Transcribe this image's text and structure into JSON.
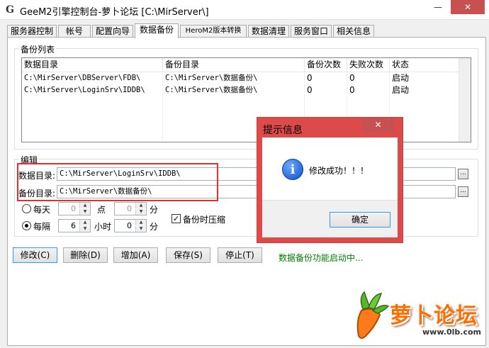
{
  "window": {
    "icon_glyph": "G",
    "title": "GeeM2引擎控制台-萝卜论坛 [C:\\MirServer\\]",
    "minimize_glyph": "—",
    "close_glyph": "✕"
  },
  "tabs": [
    {
      "label": "服务器控制"
    },
    {
      "label": "帐号"
    },
    {
      "label": "配置向导"
    },
    {
      "label": "数据备份"
    },
    {
      "label": "HeroM2版本转换"
    },
    {
      "label": "数据清理"
    },
    {
      "label": "服务窗口"
    },
    {
      "label": "相关信息"
    }
  ],
  "backup_list": {
    "group_title": "备份列表",
    "columns": [
      "数据目录",
      "备份目录",
      "备份次数",
      "失败次数",
      "状态"
    ],
    "rows": [
      {
        "data_dir": "C:\\MirServer\\DBServer\\FDB\\",
        "backup_dir": "C:\\MirServer\\数据备份\\",
        "backup_count": "0",
        "fail_count": "0",
        "status": "启动"
      },
      {
        "data_dir": "C:\\MirServer\\LoginSrv\\IDDB\\",
        "backup_dir": "C:\\MirServer\\数据备份\\",
        "backup_count": "0",
        "fail_count": "0",
        "status": "启动"
      }
    ]
  },
  "edit": {
    "group_title": "编辑",
    "data_dir_label": "数据目录:",
    "data_dir_value": "C:\\MirServer\\LoginSrv\\IDDB\\",
    "backup_dir_label": "备份目录:",
    "backup_dir_value": "C:\\MirServer\\数据备份\\",
    "browse_label": "...",
    "daily_label": "每天",
    "daily_hour": "0",
    "hour_unit": "点",
    "daily_minute": "0",
    "minute_unit": "分",
    "interval_label": "每隔",
    "interval_hours": "6",
    "hours_unit": "小时",
    "interval_minutes": "0",
    "minutes_unit": "分",
    "compress_label": "备份时压缩",
    "compress_checked": true,
    "spin_up": "▲",
    "spin_down": "▼",
    "check_mark": "✓"
  },
  "buttons": {
    "modify": "修改(C)",
    "delete": "删除(D)",
    "add": "增加(A)",
    "save": "保存(S)",
    "stop": "停止(T)"
  },
  "status_message": "数据备份功能启动中...",
  "dialog": {
    "title": "提示信息",
    "close_glyph": "✕",
    "icon_glyph": "i",
    "message": "修改成功！！！",
    "ok_label": "确定"
  },
  "logo": {
    "text": "萝卜论坛",
    "url": "www.0lb.com"
  },
  "colors": {
    "status_green": "#008000",
    "highlight_red": "#e03030",
    "dialog_frame": "#dc4a4a",
    "logo_orange": "#ff6c00"
  }
}
